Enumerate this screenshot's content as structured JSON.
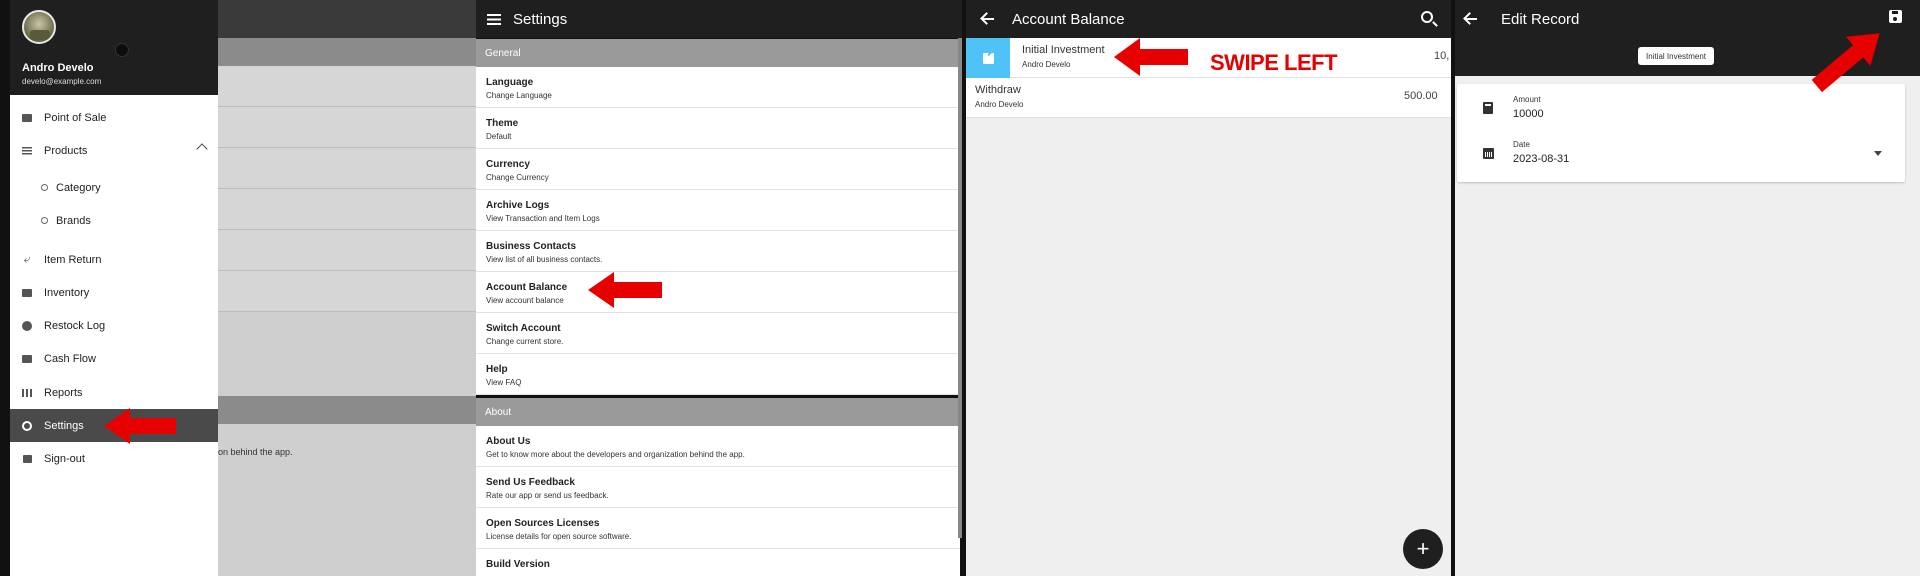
{
  "drawer": {
    "user_name": "Andro Develo",
    "user_email": "develo@example.com",
    "items": [
      {
        "label": "Point of Sale",
        "icon": "basket-icon"
      },
      {
        "label": "Products",
        "icon": "list-icon"
      },
      {
        "label": "Category",
        "icon": "circle-icon"
      },
      {
        "label": "Brands",
        "icon": "circle-icon"
      },
      {
        "label": "Item Return",
        "icon": "reply-icon"
      },
      {
        "label": "Inventory",
        "icon": "briefcase-icon"
      },
      {
        "label": "Restock Log",
        "icon": "add-circle-icon"
      },
      {
        "label": "Cash Flow",
        "icon": "wallet-icon"
      },
      {
        "label": "Reports",
        "icon": "bar-chart-icon"
      },
      {
        "label": "Settings",
        "icon": "gear-icon"
      },
      {
        "label": "Sign-out",
        "icon": "logout-icon"
      }
    ],
    "background_fragment_text": "on behind the app."
  },
  "settings": {
    "title": "Settings",
    "sections": [
      {
        "header": "General",
        "rows": [
          {
            "title": "Language",
            "subtitle": "Change Language"
          },
          {
            "title": "Theme",
            "subtitle": "Default"
          },
          {
            "title": "Currency",
            "subtitle": "Change Currency"
          },
          {
            "title": "Archive Logs",
            "subtitle": "View Transaction and Item Logs"
          },
          {
            "title": "Business Contacts",
            "subtitle": "View list of all business contacts."
          },
          {
            "title": "Account Balance",
            "subtitle": "View account balance"
          },
          {
            "title": "Switch Account",
            "subtitle": "Change current store."
          },
          {
            "title": "Help",
            "subtitle": "View FAQ"
          }
        ]
      },
      {
        "header": "About",
        "rows": [
          {
            "title": "About Us",
            "subtitle": "Get to know more about the developers and organization behind the app."
          },
          {
            "title": "Send Us Feedback",
            "subtitle": "Rate our app or send us feedback."
          },
          {
            "title": "Open Sources Licenses",
            "subtitle": "License details for open source software."
          },
          {
            "title": "Build Version",
            "subtitle": ""
          }
        ]
      }
    ]
  },
  "account_balance": {
    "title": "Account Balance",
    "records": [
      {
        "title": "Initial Investment",
        "user": "Andro Develo",
        "amount": "10,"
      },
      {
        "title": "Withdraw",
        "user": "Andro Develo",
        "amount": "500.00"
      }
    ],
    "annotation": "SWIPE LEFT",
    "fab_label": "+"
  },
  "edit_record": {
    "title": "Edit Record",
    "chip": "Initial Investment",
    "amount_label": "Amount",
    "amount_value": "10000",
    "date_label": "Date",
    "date_value": "2023-08-31"
  },
  "colors": {
    "appbar": "#1f1f1f",
    "accent_swipe": "#4fc3f7",
    "annotation_red": "#e60000",
    "section_header": "#9a9a9a"
  }
}
